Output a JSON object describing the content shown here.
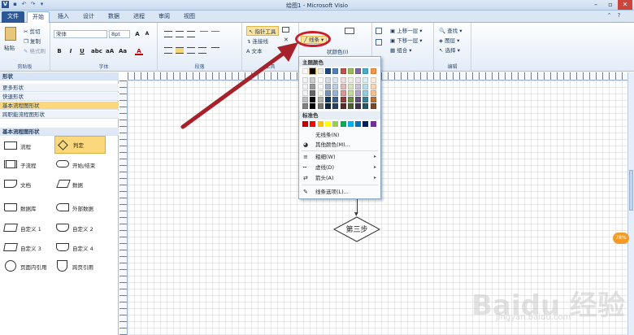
{
  "title": "绘图1 - Microsoft Visio",
  "tabs": [
    "文件",
    "开始",
    "插入",
    "设计",
    "数据",
    "进程",
    "审阅",
    "视图"
  ],
  "ribbon": {
    "clipboard": {
      "paste": "粘贴",
      "cut": "剪切",
      "copy": "复制",
      "format_painter": "格式刷",
      "label": "剪贴板"
    },
    "font": {
      "name": "宋体",
      "size": "8pt",
      "label": "字体"
    },
    "paragraph": {
      "label": "段落"
    },
    "tools": {
      "pointer": "指针工具",
      "connector": "连接线",
      "text": "文本",
      "label": "工具"
    },
    "shape": {
      "line_button": "线条",
      "fill_color_partial": "状颜色(I)"
    },
    "arrange": {
      "bring_forward": "上移一层",
      "send_backward": "下移一层",
      "group": "组合"
    },
    "editing": {
      "find": "查找",
      "layers": "图层",
      "select": "选择",
      "label": "编辑"
    }
  },
  "left_pane": {
    "header": "形状",
    "items": [
      "更多形状",
      "快速形状",
      "基本流程图形状",
      "跨职能流程图形状"
    ],
    "section_title": "基本流程图形状",
    "shapes": [
      {
        "left": "流程",
        "right": "判定"
      },
      {
        "left": "子流程",
        "right": "开始/结束"
      },
      {
        "left": "文档",
        "right": "数据"
      },
      {
        "left": "数据库",
        "right": "外部数据"
      },
      {
        "left": "自定义 1",
        "right": "自定义 2"
      },
      {
        "left": "自定义 3",
        "right": "自定义 4"
      },
      {
        "left": "页面内引用",
        "right": "跨页引用"
      }
    ]
  },
  "menu": {
    "theme_colors_header": "主题颜色",
    "standard_colors_header": "标准色",
    "no_line": "无线条(N)",
    "more_colors": "其他颜色(M)...",
    "weight": "粗细(W)",
    "dashes": "虚线(D)",
    "arrows": "箭头(A)",
    "line_options": "线条选项(L)...",
    "theme_colors": [
      "#ffffff",
      "#000000",
      "#eeece1",
      "#1f497d",
      "#4f81bd",
      "#c0504d",
      "#9bbb59",
      "#8064a2",
      "#4bacc6",
      "#f79646"
    ],
    "standard_colors": [
      "#c00000",
      "#ff0000",
      "#ffc000",
      "#ffff00",
      "#92d050",
      "#00b050",
      "#00b0f0",
      "#0070c0",
      "#002060",
      "#7030a0"
    ]
  },
  "canvas": {
    "diamond_text": "第三步"
  },
  "badge": "78%",
  "watermark": {
    "main": "Baidu 经验",
    "sub": "jingyan.baidu.com"
  }
}
